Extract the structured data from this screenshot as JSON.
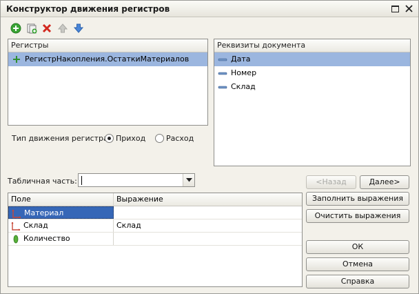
{
  "window": {
    "title": "Конструктор движения регистров"
  },
  "toolbar": {
    "icons": [
      "add-icon",
      "copy-icon",
      "delete-icon",
      "move-up-icon",
      "move-down-icon"
    ]
  },
  "registers": {
    "header": "Регистры",
    "items": [
      {
        "label": "РегистрНакопления.ОстаткиМатериалов",
        "selected": true
      }
    ]
  },
  "requisites": {
    "header": "Реквизиты документа",
    "items": [
      {
        "label": "Дата",
        "selected": true
      },
      {
        "label": "Номер",
        "selected": false
      },
      {
        "label": "Склад",
        "selected": false
      }
    ]
  },
  "movement_type": {
    "label": "Тип движения регистра:",
    "options": [
      {
        "label": "Приход",
        "checked": true
      },
      {
        "label": "Расход",
        "checked": false
      }
    ]
  },
  "tabular": {
    "label": "Табличная часть:",
    "value": ""
  },
  "nav": {
    "back": "<Назад",
    "back_accel": "Н",
    "next": "Далее>",
    "next_accel": "Д"
  },
  "actions": {
    "fill": "Заполнить выражения",
    "fill_accel": "З",
    "clear": "Очистить выражения",
    "clear_accel": "ч"
  },
  "grid": {
    "columns": [
      "Поле",
      "Выражение"
    ],
    "rows": [
      {
        "field": "Материал",
        "expression": "",
        "icon": "dimension-icon",
        "selected": true
      },
      {
        "field": "Склад",
        "expression": "Склад",
        "icon": "dimension-icon",
        "selected": false
      },
      {
        "field": "Количество",
        "expression": "",
        "icon": "resource-icon",
        "selected": false
      }
    ]
  },
  "dialog_buttons": {
    "ok": "ОК",
    "cancel": "Отмена",
    "help": "Справка"
  },
  "colors": {
    "selection": "#9bb6df",
    "grid_selection": "#3667b7",
    "window_bg": "#f3f1ea"
  }
}
